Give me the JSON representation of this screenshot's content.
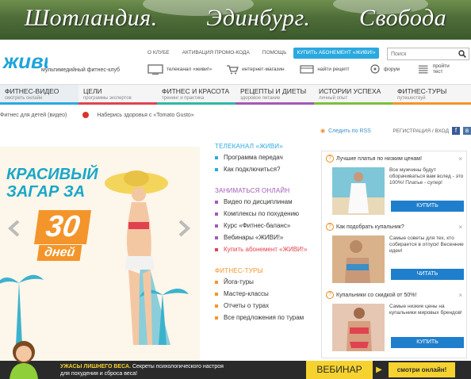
{
  "banner": {
    "words": [
      "Шотландия.",
      "Эдинбург.",
      "Свобода"
    ]
  },
  "header": {
    "logo_text": "живи!",
    "tagline": "мультимедийный фитнес-клуб",
    "topnav": [
      "О клубе",
      "Активация промо-кода",
      "Помощь"
    ],
    "buy_button": "Купить абонемент «ЖИВИ!»",
    "search_placeholder": "Поиск",
    "icons": [
      {
        "label": "телеканал «живи!»",
        "icon": "tv-icon"
      },
      {
        "label": "интернет-магазин",
        "icon": "cart-icon"
      },
      {
        "label": "найти рецепт",
        "icon": "recipe-icon"
      },
      {
        "label": "форум",
        "icon": "forum-icon"
      },
      {
        "label": "пройти тест",
        "icon": "test-icon"
      }
    ]
  },
  "mainnav": [
    {
      "title": "Фитнес-видео",
      "sub": "смотреть онлайн",
      "color": "#2aa9e0"
    },
    {
      "title": "Цели",
      "sub": "программы экспертов",
      "color": "#e0434f"
    },
    {
      "title": "Фитнес и красота",
      "sub": "тренинг и практика",
      "color": "#2fb8a8"
    },
    {
      "title": "Рецепты и диеты",
      "sub": "здоровое питание",
      "color": "#a05bb5"
    },
    {
      "title": "Истории успеха",
      "sub": "личный опыт",
      "color": "#7bbf3a"
    },
    {
      "title": "Фитнес-туры",
      "sub": "путешествуй",
      "color": "#f3952a"
    }
  ],
  "subnav": {
    "breadcrumb": "Фитнес для детей (видео)",
    "promo": "Наберись здоровья с «Tomato Gusto»"
  },
  "rss": {
    "label": "Следить по RSS",
    "register": "Регистрация",
    "login": "Вход"
  },
  "promo": {
    "line1": "Красивый",
    "line2": "загар за",
    "number": "30",
    "days": "дней"
  },
  "sections": [
    {
      "title": "Телеканал «Живи»",
      "color": "#2aa9e0",
      "items": [
        "Программа передач",
        "Как подключиться?"
      ]
    },
    {
      "title": "Заниматься онлайн",
      "color": "#a05bb5",
      "items": [
        "Видео по дисциплинам",
        "Комплексы по похудению",
        "Курс «Фитнес-баланс»",
        "Вебинары «ЖИВИ!»",
        "Купить абонемент «ЖИВИ!»"
      ]
    },
    {
      "title": "Фитнес-туры",
      "color": "#f3952a",
      "items": [
        "Йога-туры",
        "Мастер-классы",
        "Отчеты о турах",
        "Все предложения по турам"
      ]
    }
  ],
  "ads": [
    {
      "title": "Лучшие платья по низким ценам!",
      "desc": "Все мужчины будут оборачиваться вам вслед - это 100%! Платье - супер!",
      "button": "Купить"
    },
    {
      "title": "Как подобрать купальник?",
      "desc": "Самые советы для тех, кто собирается в отпуск! Весенние идеи!",
      "button": "Читать"
    },
    {
      "title": "Купальники со скидкой от 50%!",
      "desc": "Самые низкие цены на купальники мировых брендов!",
      "button": "Купить"
    }
  ],
  "bottombar": {
    "highlight": "УЖАСЫ ЛИШНЕГО ВЕСА.",
    "text": "Секреты психологического настроя",
    "text2": "для похудения и сброса веса!",
    "webinar": "ВЕБИНАР",
    "watch": "смотри онлайн!"
  }
}
